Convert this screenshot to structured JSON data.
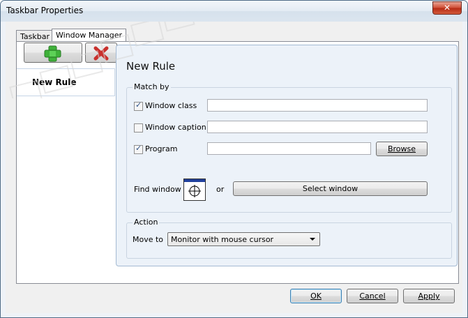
{
  "window": {
    "title": "Taskbar Properties",
    "close_glyph": "✕"
  },
  "tabs": [
    {
      "label": "Taskbar",
      "active": false
    },
    {
      "label": "Window Manager",
      "active": true
    }
  ],
  "rule_toolbar": {
    "add_icon": "plus-icon",
    "delete_icon": "x-icon"
  },
  "rule_list": [
    "New Rule"
  ],
  "rule_editor": {
    "heading": "New Rule",
    "match_group": "Match by",
    "window_class": {
      "label": "Window class",
      "checked": true,
      "value": ""
    },
    "window_caption": {
      "label": "Window caption",
      "checked": false,
      "value": ""
    },
    "program": {
      "label": "Program",
      "checked": true,
      "value": ""
    },
    "browse_label": "Browse",
    "find_window_label": "Find window",
    "or_label": "or",
    "select_window_label": "Select window",
    "action_group": "Action",
    "move_to_label": "Move to",
    "move_to_value": "Monitor with mouse cursor"
  },
  "buttons": {
    "ok": "OK",
    "cancel": "Cancel",
    "apply": "Apply"
  },
  "check_glyph": "✓",
  "colors": {
    "title_bar": "#dbe5ef",
    "close_button": "#c9432b",
    "panel": "#ecf2f9"
  }
}
